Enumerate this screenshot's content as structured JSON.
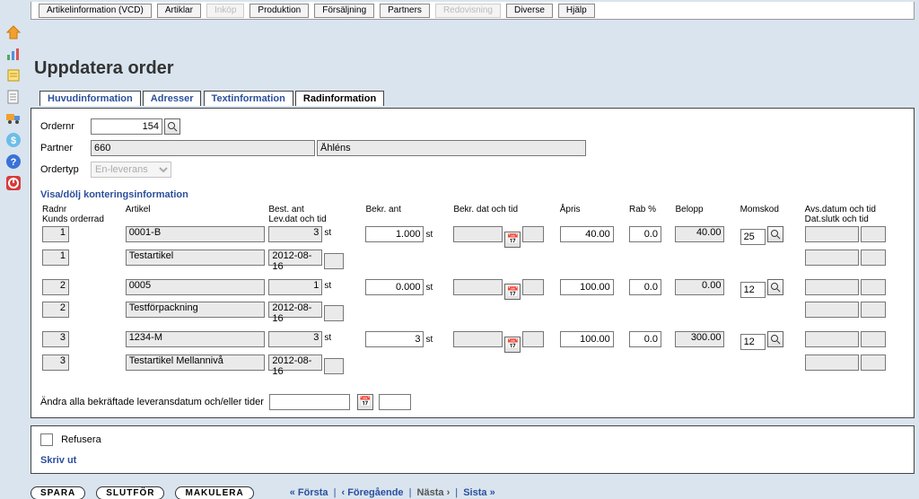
{
  "menu": {
    "artikelinfo": "Artikelinformation (VCD)",
    "artiklar": "Artiklar",
    "inkop": "Inköp",
    "produktion": "Produktion",
    "forsaljning": "Försäljning",
    "partners": "Partners",
    "redovisning": "Redovisning",
    "diverse": "Diverse",
    "hjalp": "Hjälp"
  },
  "title": "Uppdatera order",
  "tabs": {
    "huvud": "Huvudinformation",
    "adresser": "Adresser",
    "textinfo": "Textinformation",
    "radinfo": "Radinformation"
  },
  "header": {
    "ordernr_label": "Ordernr",
    "ordernr_value": "154",
    "partner_label": "Partner",
    "partner_code": "660",
    "partner_name": "Åhléns",
    "ordertyp_label": "Ordertyp",
    "ordertyp_value": "En-leverans"
  },
  "konteringsToggle": "Visa/dölj konteringsinformation",
  "cols": {
    "radnr": "Radnr\nKunds orderrad",
    "artikel": "Artikel",
    "bestant": "Best. ant\nLev.dat och tid",
    "bekrant": "Bekr. ant",
    "bekrdat": "Bekr. dat och tid",
    "apris": "Åpris",
    "rab": "Rab %",
    "belopp": "Belopp",
    "momskod": "Momskod",
    "avsdatum": "Avs.datum och tid\nDat.slutk och tid"
  },
  "unit_each": "st",
  "rows": [
    {
      "radnr1": "1",
      "radnr2": "1",
      "artikel_code": "0001-B",
      "artikel_name": "Testartikel",
      "best_ant": "3",
      "lev_dat": "2012-08-16",
      "bekr_ant": "1.000",
      "apris": "40.00",
      "rab": "0.0",
      "belopp": "40.00",
      "moms": "25"
    },
    {
      "radnr1": "2",
      "radnr2": "2",
      "artikel_code": "0005",
      "artikel_name": "Testförpackning",
      "best_ant": "1",
      "lev_dat": "2012-08-16",
      "bekr_ant": "0.000",
      "apris": "100.00",
      "rab": "0.0",
      "belopp": "0.00",
      "moms": "12"
    },
    {
      "radnr1": "3",
      "radnr2": "3",
      "artikel_code": "1234-M",
      "artikel_name": "Testartikel Mellannivå",
      "best_ant": "3",
      "lev_dat": "2012-08-16",
      "bekr_ant": "3",
      "apris": "100.00",
      "rab": "0.0",
      "belopp": "300.00",
      "moms": "12"
    }
  ],
  "bulk_label": "Ändra alla bekräftade leveransdatum och/eller tider",
  "refusera_label": "Refusera",
  "skriv_ut": "Skriv ut",
  "buttons": {
    "spara": "SPARA",
    "slutfor": "SLUTFÖR",
    "makulera": "MAKULERA"
  },
  "paging": {
    "first": "« Första",
    "prev": "‹ Föregående",
    "next": "Nästa ›",
    "last": "Sista »"
  }
}
